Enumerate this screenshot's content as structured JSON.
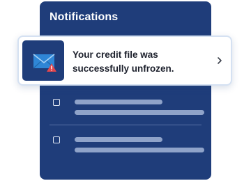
{
  "panel": {
    "title": "Notifications",
    "background_color": "#1f3d7a"
  },
  "notification": {
    "message": "Your credit file was successfully unfrozen.",
    "icon": "envelope-alert-icon",
    "chevron": "chevron-right-icon",
    "accent_color": "#2f86d6",
    "alert_color": "#e2464c"
  },
  "placeholder_rows": [
    {
      "icon": "checkbox-icon"
    },
    {
      "icon": "checkbox-icon"
    }
  ]
}
